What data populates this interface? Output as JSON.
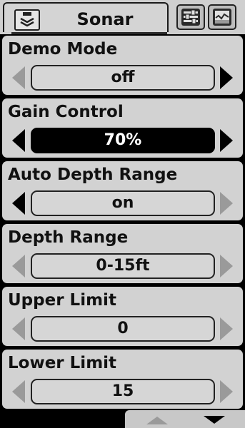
{
  "header": {
    "title": "Sonar",
    "icons": [
      "sonar-icon",
      "settings-sliders-icon",
      "chart-display-icon"
    ]
  },
  "rows": [
    {
      "label": "Demo Mode",
      "value": "off",
      "selected": false,
      "left_arrow": "disabled",
      "right_arrow": "enabled"
    },
    {
      "label": "Gain Control",
      "value": "70%",
      "selected": true,
      "left_arrow": "enabled",
      "right_arrow": "enabled"
    },
    {
      "label": "Auto Depth Range",
      "value": "on",
      "selected": false,
      "left_arrow": "enabled",
      "right_arrow": "disabled"
    },
    {
      "label": "Depth Range",
      "value": "0-15ft",
      "selected": false,
      "left_arrow": "disabled",
      "right_arrow": "disabled"
    },
    {
      "label": "Upper Limit",
      "value": "0",
      "selected": false,
      "left_arrow": "disabled",
      "right_arrow": "disabled"
    },
    {
      "label": "Lower Limit",
      "value": "15",
      "selected": false,
      "left_arrow": "disabled",
      "right_arrow": "disabled"
    }
  ],
  "footer": {
    "icons": [
      "scroll-up-icon",
      "scroll-down-icon"
    ]
  },
  "colors": {
    "panel": "#d2d2d2",
    "background": "#000000",
    "text": "#111111",
    "arrow_enabled": "#000000",
    "arrow_disabled": "#9a9a9a",
    "selected_bg": "#000000",
    "selected_text": "#ffffff"
  }
}
